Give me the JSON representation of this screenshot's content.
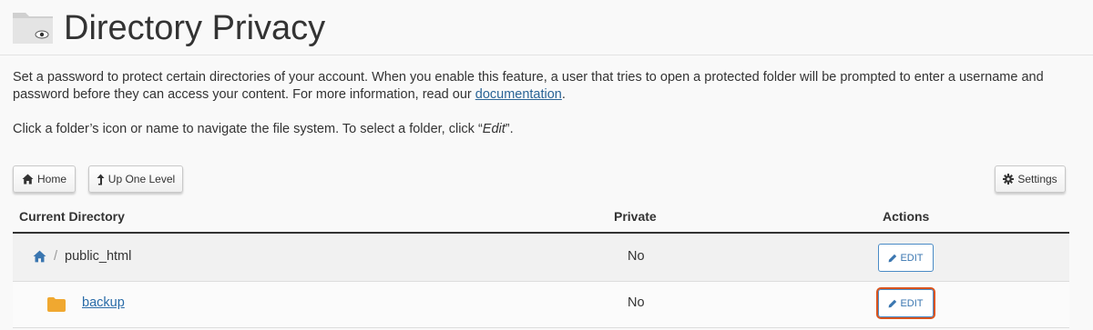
{
  "header": {
    "title": "Directory Privacy",
    "icon": "folder-eye-icon"
  },
  "intro": {
    "text_before_link": "Set a password to protect certain directories of your account. When you enable this feature, a user that tries to open a protected folder will be prompted to enter a username and password before they can access your content. For more information, read our ",
    "link_text": "documentation",
    "text_after_link": "."
  },
  "hint": {
    "before": "Click a folder’s icon or name to navigate the file system. To select a folder, click “",
    "emphasis": "Edit",
    "after": "”."
  },
  "toolbar": {
    "home_label": "Home",
    "up_label": "Up One Level",
    "settings_label": "Settings"
  },
  "table": {
    "columns": [
      "Current Directory",
      "Private",
      "Actions"
    ],
    "current": {
      "separator": "/",
      "name": "public_html",
      "private": "No",
      "action_label": "EDIT"
    },
    "rows": [
      {
        "name": "backup",
        "private": "No",
        "action_label": "EDIT"
      }
    ]
  },
  "colors": {
    "link": "#2a6496",
    "accent": "#4a8bc6",
    "folder": "#f0a830",
    "highlight": "#d9541e"
  }
}
